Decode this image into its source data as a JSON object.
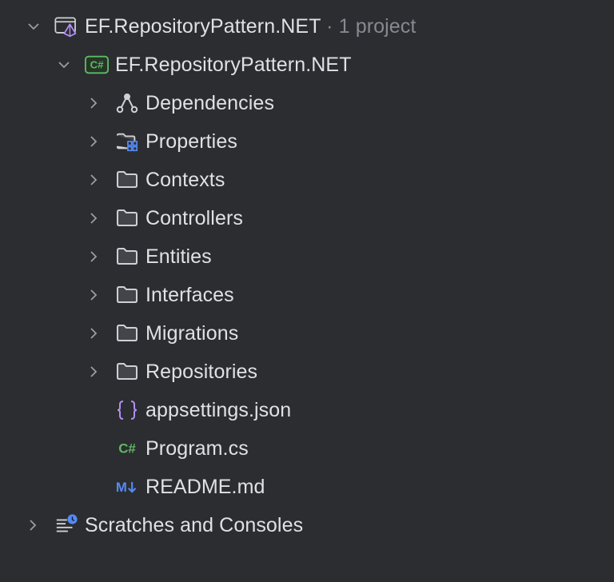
{
  "solution": {
    "name": "EF.RepositoryPattern.NET",
    "suffix": "· 1 project",
    "expanded": true,
    "icon": "solution-icon"
  },
  "project": {
    "name": "EF.RepositoryPattern.NET",
    "expanded": true,
    "icon": "csharp-project-icon"
  },
  "children": [
    {
      "label": "Dependencies",
      "icon": "dependencies-icon",
      "expandable": true
    },
    {
      "label": "Properties",
      "icon": "properties-folder-icon",
      "expandable": true
    },
    {
      "label": "Contexts",
      "icon": "folder-icon",
      "expandable": true
    },
    {
      "label": "Controllers",
      "icon": "folder-icon",
      "expandable": true
    },
    {
      "label": "Entities",
      "icon": "folder-icon",
      "expandable": true
    },
    {
      "label": "Interfaces",
      "icon": "folder-icon",
      "expandable": true
    },
    {
      "label": "Migrations",
      "icon": "folder-icon",
      "expandable": true
    },
    {
      "label": "Repositories",
      "icon": "folder-icon",
      "expandable": true
    },
    {
      "label": "appsettings.json",
      "icon": "json-file-icon",
      "expandable": false
    },
    {
      "label": "Program.cs",
      "icon": "csharp-file-icon",
      "expandable": false
    },
    {
      "label": "README.md",
      "icon": "markdown-file-icon",
      "expandable": false
    }
  ],
  "scratches": {
    "label": "Scratches and Consoles",
    "icon": "scratches-icon",
    "expanded": false
  },
  "colors": {
    "background": "#2b2d30",
    "text": "#dfe1e5",
    "muted": "#868991",
    "csharp_green": "#5fb865",
    "json_purple": "#b38ef5",
    "markdown_blue": "#548af7"
  }
}
